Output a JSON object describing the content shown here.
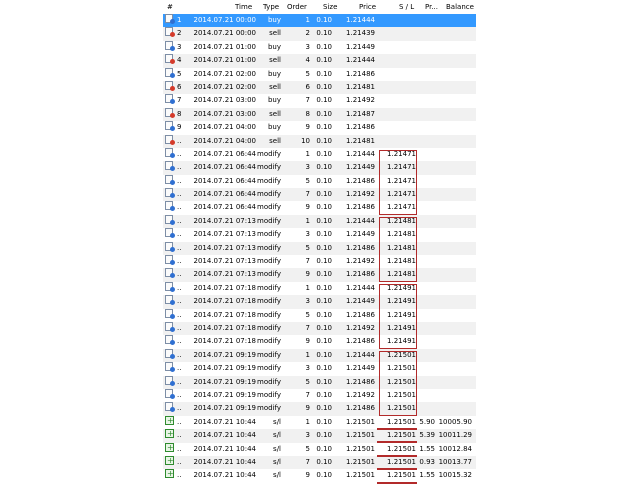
{
  "columns": [
    "#",
    "Time",
    "Type",
    "Order",
    "Size",
    "Price",
    "S / L",
    "Pr...",
    "Balance"
  ],
  "rows": [
    {
      "num": "1",
      "time": "2014.07.21 00:00",
      "type": "buy",
      "order": "1",
      "size": "0.10",
      "price": "1.21444",
      "sl": "",
      "profit": "",
      "balance": "",
      "icon": "buy"
    },
    {
      "num": "2",
      "time": "2014.07.21 00:00",
      "type": "sell",
      "order": "2",
      "size": "0.10",
      "price": "1.21439",
      "sl": "",
      "profit": "",
      "balance": "",
      "icon": "sell"
    },
    {
      "num": "3",
      "time": "2014.07.21 01:00",
      "type": "buy",
      "order": "3",
      "size": "0.10",
      "price": "1.21449",
      "sl": "",
      "profit": "",
      "balance": "",
      "icon": "buy"
    },
    {
      "num": "4",
      "time": "2014.07.21 01:00",
      "type": "sell",
      "order": "4",
      "size": "0.10",
      "price": "1.21444",
      "sl": "",
      "profit": "",
      "balance": "",
      "icon": "sell"
    },
    {
      "num": "5",
      "time": "2014.07.21 02:00",
      "type": "buy",
      "order": "5",
      "size": "0.10",
      "price": "1.21486",
      "sl": "",
      "profit": "",
      "balance": "",
      "icon": "buy"
    },
    {
      "num": "6",
      "time": "2014.07.21 02:00",
      "type": "sell",
      "order": "6",
      "size": "0.10",
      "price": "1.21481",
      "sl": "",
      "profit": "",
      "balance": "",
      "icon": "sell"
    },
    {
      "num": "7",
      "time": "2014.07.21 03:00",
      "type": "buy",
      "order": "7",
      "size": "0.10",
      "price": "1.21492",
      "sl": "",
      "profit": "",
      "balance": "",
      "icon": "buy"
    },
    {
      "num": "8",
      "time": "2014.07.21 03:00",
      "type": "sell",
      "order": "8",
      "size": "0.10",
      "price": "1.21487",
      "sl": "",
      "profit": "",
      "balance": "",
      "icon": "sell"
    },
    {
      "num": "9",
      "time": "2014.07.21 04:00",
      "type": "buy",
      "order": "9",
      "size": "0.10",
      "price": "1.21486",
      "sl": "",
      "profit": "",
      "balance": "",
      "icon": "buy"
    },
    {
      "num": "..",
      "time": "2014.07.21 04:00",
      "type": "sell",
      "order": "10",
      "size": "0.10",
      "price": "1.21481",
      "sl": "",
      "profit": "",
      "balance": "",
      "icon": "sell"
    },
    {
      "num": "..",
      "time": "2014.07.21 06:44",
      "type": "modify",
      "order": "1",
      "size": "0.10",
      "price": "1.21444",
      "sl": "1.21471",
      "profit": "",
      "balance": "",
      "icon": "mod"
    },
    {
      "num": "..",
      "time": "2014.07.21 06:44",
      "type": "modify",
      "order": "3",
      "size": "0.10",
      "price": "1.21449",
      "sl": "1.21471",
      "profit": "",
      "balance": "",
      "icon": "mod"
    },
    {
      "num": "..",
      "time": "2014.07.21 06:44",
      "type": "modify",
      "order": "5",
      "size": "0.10",
      "price": "1.21486",
      "sl": "1.21471",
      "profit": "",
      "balance": "",
      "icon": "mod"
    },
    {
      "num": "..",
      "time": "2014.07.21 06:44",
      "type": "modify",
      "order": "7",
      "size": "0.10",
      "price": "1.21492",
      "sl": "1.21471",
      "profit": "",
      "balance": "",
      "icon": "mod"
    },
    {
      "num": "..",
      "time": "2014.07.21 06:44",
      "type": "modify",
      "order": "9",
      "size": "0.10",
      "price": "1.21486",
      "sl": "1.21471",
      "profit": "",
      "balance": "",
      "icon": "mod"
    },
    {
      "num": "..",
      "time": "2014.07.21 07:13",
      "type": "modify",
      "order": "1",
      "size": "0.10",
      "price": "1.21444",
      "sl": "1.21481",
      "profit": "",
      "balance": "",
      "icon": "mod"
    },
    {
      "num": "..",
      "time": "2014.07.21 07:13",
      "type": "modify",
      "order": "3",
      "size": "0.10",
      "price": "1.21449",
      "sl": "1.21481",
      "profit": "",
      "balance": "",
      "icon": "mod"
    },
    {
      "num": "..",
      "time": "2014.07.21 07:13",
      "type": "modify",
      "order": "5",
      "size": "0.10",
      "price": "1.21486",
      "sl": "1.21481",
      "profit": "",
      "balance": "",
      "icon": "mod"
    },
    {
      "num": "..",
      "time": "2014.07.21 07:13",
      "type": "modify",
      "order": "7",
      "size": "0.10",
      "price": "1.21492",
      "sl": "1.21481",
      "profit": "",
      "balance": "",
      "icon": "mod"
    },
    {
      "num": "..",
      "time": "2014.07.21 07:13",
      "type": "modify",
      "order": "9",
      "size": "0.10",
      "price": "1.21486",
      "sl": "1.21481",
      "profit": "",
      "balance": "",
      "icon": "mod"
    },
    {
      "num": "..",
      "time": "2014.07.21 07:18",
      "type": "modify",
      "order": "1",
      "size": "0.10",
      "price": "1.21444",
      "sl": "1.21491",
      "profit": "",
      "balance": "",
      "icon": "mod"
    },
    {
      "num": "..",
      "time": "2014.07.21 07:18",
      "type": "modify",
      "order": "3",
      "size": "0.10",
      "price": "1.21449",
      "sl": "1.21491",
      "profit": "",
      "balance": "",
      "icon": "mod"
    },
    {
      "num": "..",
      "time": "2014.07.21 07:18",
      "type": "modify",
      "order": "5",
      "size": "0.10",
      "price": "1.21486",
      "sl": "1.21491",
      "profit": "",
      "balance": "",
      "icon": "mod"
    },
    {
      "num": "..",
      "time": "2014.07.21 07:18",
      "type": "modify",
      "order": "7",
      "size": "0.10",
      "price": "1.21492",
      "sl": "1.21491",
      "profit": "",
      "balance": "",
      "icon": "mod"
    },
    {
      "num": "..",
      "time": "2014.07.21 07:18",
      "type": "modify",
      "order": "9",
      "size": "0.10",
      "price": "1.21486",
      "sl": "1.21491",
      "profit": "",
      "balance": "",
      "icon": "mod"
    },
    {
      "num": "..",
      "time": "2014.07.21 09:19",
      "type": "modify",
      "order": "1",
      "size": "0.10",
      "price": "1.21444",
      "sl": "1.21501",
      "profit": "",
      "balance": "",
      "icon": "mod"
    },
    {
      "num": "..",
      "time": "2014.07.21 09:19",
      "type": "modify",
      "order": "3",
      "size": "0.10",
      "price": "1.21449",
      "sl": "1.21501",
      "profit": "",
      "balance": "",
      "icon": "mod"
    },
    {
      "num": "..",
      "time": "2014.07.21 09:19",
      "type": "modify",
      "order": "5",
      "size": "0.10",
      "price": "1.21486",
      "sl": "1.21501",
      "profit": "",
      "balance": "",
      "icon": "mod"
    },
    {
      "num": "..",
      "time": "2014.07.21 09:19",
      "type": "modify",
      "order": "7",
      "size": "0.10",
      "price": "1.21492",
      "sl": "1.21501",
      "profit": "",
      "balance": "",
      "icon": "mod"
    },
    {
      "num": "..",
      "time": "2014.07.21 09:19",
      "type": "modify",
      "order": "9",
      "size": "0.10",
      "price": "1.21486",
      "sl": "1.21501",
      "profit": "",
      "balance": "",
      "icon": "mod"
    },
    {
      "num": "..",
      "time": "2014.07.21 10:44",
      "type": "s/l",
      "order": "1",
      "size": "0.10",
      "price": "1.21501",
      "sl": "1.21501",
      "profit": "5.90",
      "balance": "10005.90",
      "icon": "sl"
    },
    {
      "num": "..",
      "time": "2014.07.21 10:44",
      "type": "s/l",
      "order": "3",
      "size": "0.10",
      "price": "1.21501",
      "sl": "1.21501",
      "profit": "5.39",
      "balance": "10011.29",
      "icon": "sl"
    },
    {
      "num": "..",
      "time": "2014.07.21 10:44",
      "type": "s/l",
      "order": "5",
      "size": "0.10",
      "price": "1.21501",
      "sl": "1.21501",
      "profit": "1.55",
      "balance": "10012.84",
      "icon": "sl"
    },
    {
      "num": "..",
      "time": "2014.07.21 10:44",
      "type": "s/l",
      "order": "7",
      "size": "0.10",
      "price": "1.21501",
      "sl": "1.21501",
      "profit": "0.93",
      "balance": "10013.77",
      "icon": "sl"
    },
    {
      "num": "..",
      "time": "2014.07.21 10:44",
      "type": "s/l",
      "order": "9",
      "size": "0.10",
      "price": "1.21501",
      "sl": "1.21501",
      "profit": "1.55",
      "balance": "10015.32",
      "icon": "sl"
    }
  ],
  "colors": {
    "selected_row": "#3399ff",
    "highlight": "#b22a2a",
    "stripe": "#f1f1f1"
  }
}
